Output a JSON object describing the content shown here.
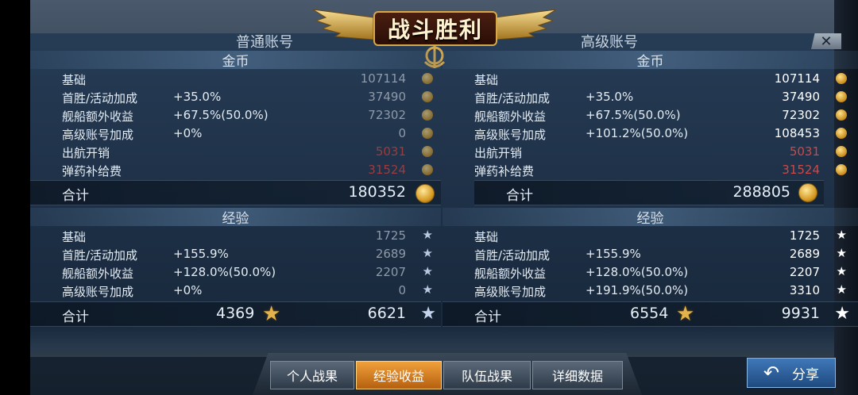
{
  "title": "战斗胜利",
  "close_symbol": "✕",
  "normal": {
    "heading": "普通账号",
    "gold": {
      "section": "金币",
      "rows": [
        {
          "label": "基础",
          "pct": "",
          "value": "107114",
          "neg": false
        },
        {
          "label": "首胜/活动加成",
          "pct": "+35.0%",
          "value": "37490",
          "neg": false
        },
        {
          "label": "舰船额外收益",
          "pct": "+67.5%(50.0%)",
          "value": "72302",
          "neg": false
        },
        {
          "label": "高级账号加成",
          "pct": "+0%",
          "value": "0",
          "neg": false
        },
        {
          "label": "出航开销",
          "pct": "",
          "value": "5031",
          "neg": true
        },
        {
          "label": "弹药补给费",
          "pct": "",
          "value": "31524",
          "neg": true
        }
      ],
      "total_label": "合计",
      "total": "180352"
    },
    "exp": {
      "section": "经验",
      "rows": [
        {
          "label": "基础",
          "pct": "",
          "value": "1725"
        },
        {
          "label": "首胜/活动加成",
          "pct": "+155.9%",
          "value": "2689"
        },
        {
          "label": "舰船额外收益",
          "pct": "+128.0%(50.0%)",
          "value": "2207"
        },
        {
          "label": "高级账号加成",
          "pct": "+0%",
          "value": "0"
        }
      ],
      "total_label": "合计",
      "total_captain": "4369",
      "total": "6621"
    }
  },
  "premium": {
    "heading": "高级账号",
    "gold": {
      "section": "金币",
      "rows": [
        {
          "label": "基础",
          "pct": "",
          "value": "107114",
          "neg": false
        },
        {
          "label": "首胜/活动加成",
          "pct": "+35.0%",
          "value": "37490",
          "neg": false
        },
        {
          "label": "舰船额外收益",
          "pct": "+67.5%(50.0%)",
          "value": "72302",
          "neg": false
        },
        {
          "label": "高级账号加成",
          "pct": "+101.2%(50.0%)",
          "value": "108453",
          "neg": false
        },
        {
          "label": "出航开销",
          "pct": "",
          "value": "5031",
          "neg": true
        },
        {
          "label": "弹药补给费",
          "pct": "",
          "value": "31524",
          "neg": true
        }
      ],
      "total_label": "合计",
      "total": "288805"
    },
    "exp": {
      "section": "经验",
      "rows": [
        {
          "label": "基础",
          "pct": "",
          "value": "1725"
        },
        {
          "label": "首胜/活动加成",
          "pct": "+155.9%",
          "value": "2689"
        },
        {
          "label": "舰船额外收益",
          "pct": "+128.0%(50.0%)",
          "value": "2207"
        },
        {
          "label": "高级账号加成",
          "pct": "+191.9%(50.0%)",
          "value": "3310"
        }
      ],
      "total_label": "合计",
      "total_captain": "6554",
      "total": "9931"
    }
  },
  "tabs": [
    {
      "label": "个人战果",
      "active": false
    },
    {
      "label": "经验收益",
      "active": true
    },
    {
      "label": "队伍战果",
      "active": false
    },
    {
      "label": "详细数据",
      "active": false
    }
  ],
  "share": {
    "label": "分享",
    "icon": "↶"
  },
  "icons": {
    "coin": "gold-coin-icon",
    "star": "★"
  },
  "colors": {
    "negative": "#c84a4a",
    "active_tab": "#e8922e",
    "gold": "#e3b24a"
  }
}
